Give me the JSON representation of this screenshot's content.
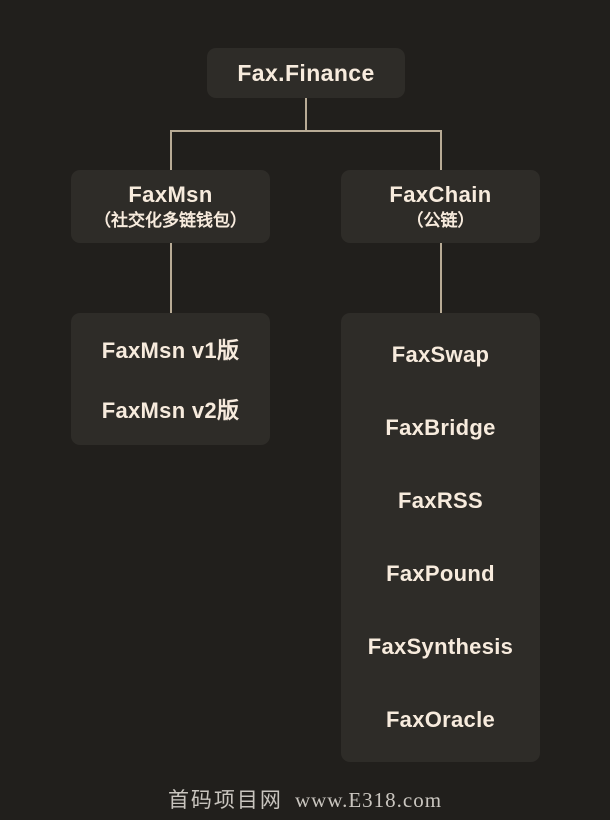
{
  "diagram": {
    "type": "tree",
    "root": {
      "title": "Fax.Finance"
    },
    "branches": [
      {
        "title": "FaxMsn",
        "subtitle": "（社交化多链钱包）",
        "children": [
          {
            "label": "FaxMsn v1版"
          },
          {
            "label": "FaxMsn v2版"
          }
        ]
      },
      {
        "title": "FaxChain",
        "subtitle": "（公链）",
        "children": [
          {
            "label": "FaxSwap"
          },
          {
            "label": "FaxBridge"
          },
          {
            "label": "FaxRSS"
          },
          {
            "label": "FaxPound"
          },
          {
            "label": "FaxSynthesis"
          },
          {
            "label": "FaxOracle"
          }
        ]
      }
    ]
  },
  "watermark": {
    "site_name": "首码项目网",
    "url": "www.E318.com"
  },
  "colors": {
    "background": "#211f1c",
    "node_fill": "#2e2c28",
    "text": "#f7ebdd",
    "connector": "#b8ab95",
    "watermark_text": "#d8d4cd"
  }
}
